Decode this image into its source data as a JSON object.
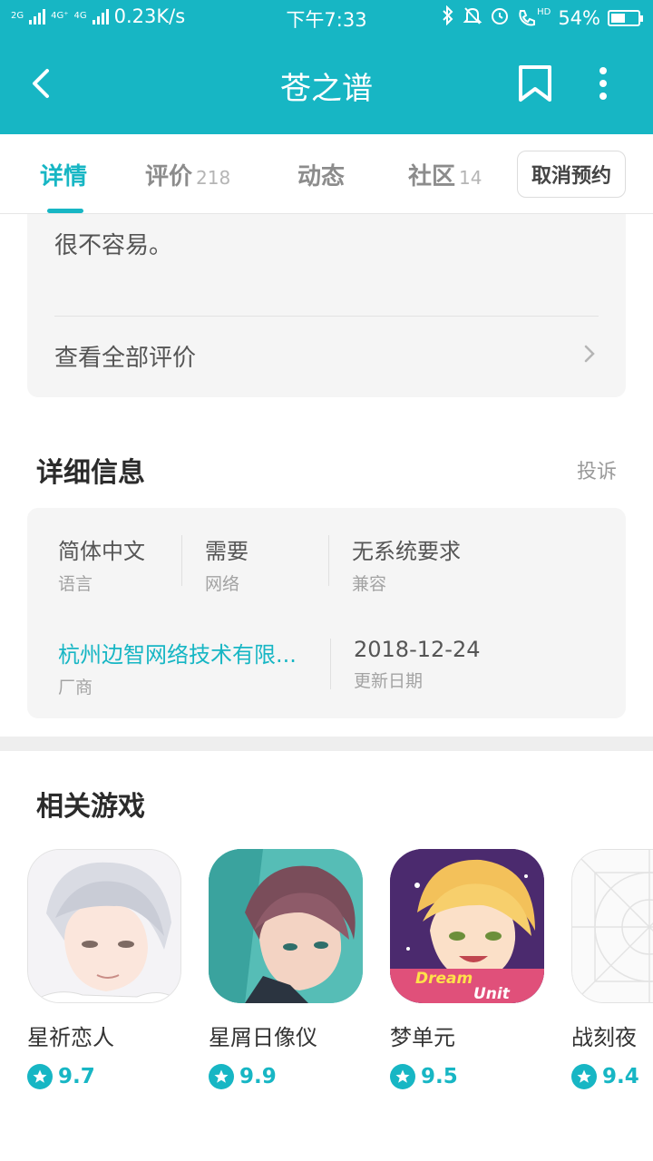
{
  "status_bar": {
    "net_2g": "2G",
    "net_4g_1": "4G⁺",
    "net_4g_2": "4G",
    "speed": "0.23K/s",
    "time": "下午7:33",
    "hd": "HD",
    "battery_text": "54%",
    "battery_level_percent": 54
  },
  "app_bar": {
    "title": "苍之谱"
  },
  "tabs": [
    {
      "label": "详情",
      "count": ""
    },
    {
      "label": "评价",
      "count": "218"
    },
    {
      "label": "动态",
      "count": ""
    },
    {
      "label": "社区",
      "count": "14"
    }
  ],
  "cancel_reservation": "取消预约",
  "review": {
    "text_tail": "很不容易。",
    "view_all": "查看全部评价"
  },
  "details": {
    "title": "详细信息",
    "report": "投诉",
    "language": {
      "value": "简体中文",
      "label": "语言"
    },
    "network": {
      "value": "需要",
      "label": "网络"
    },
    "compat": {
      "value": "无系统要求",
      "label": "兼容"
    },
    "vendor": {
      "value": "杭州边智网络技术有限...",
      "label": "厂商"
    },
    "updated": {
      "value": "2018-12-24",
      "label": "更新日期"
    }
  },
  "related": {
    "title": "相关游戏",
    "games": [
      {
        "name": "星祈恋人",
        "rating": "9.7"
      },
      {
        "name": "星屑日像仪",
        "rating": "9.9"
      },
      {
        "name": "梦单元",
        "rating": "9.5",
        "icon_text_1": "Dream",
        "icon_text_2": "Unit"
      },
      {
        "name": "战刻夜",
        "rating": "9.4"
      }
    ]
  },
  "colors": {
    "accent": "#17b6c4",
    "card_bg": "#f5f5f5"
  }
}
